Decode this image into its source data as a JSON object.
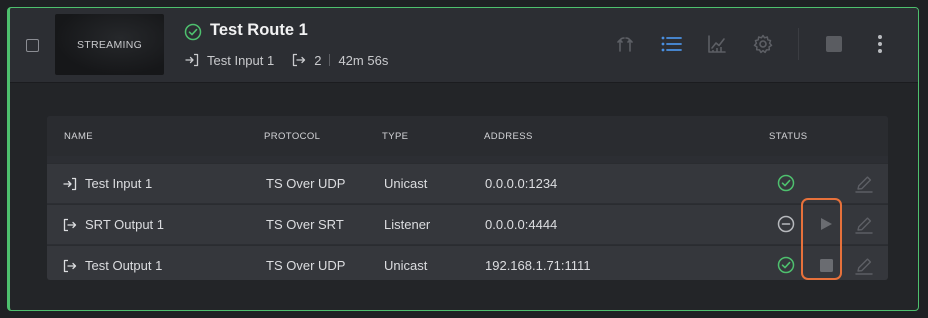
{
  "route": {
    "title": "Test Route 1",
    "status": "ok",
    "thumbnail_label": "STREAMING",
    "input_name": "Test Input 1",
    "output_count": "2",
    "uptime": "42m 56s"
  },
  "toolbar": {
    "icons": [
      "routing-icon",
      "list-icon",
      "chart-icon",
      "gear-icon",
      "stop-icon",
      "more-vertical-icon"
    ],
    "active": "list-icon"
  },
  "table": {
    "columns": [
      "NAME",
      "PROTOCOL",
      "TYPE",
      "ADDRESS",
      "STATUS"
    ],
    "rows": [
      {
        "direction": "input",
        "name": "Test Input 1",
        "protocol": "TS Over UDP",
        "type": "Unicast",
        "address": "0.0.0.0:1234",
        "status": "ok",
        "action": "none"
      },
      {
        "direction": "output",
        "name": "SRT Output 1",
        "protocol": "TS Over SRT",
        "type": "Listener",
        "address": "0.0.0.0:4444",
        "status": "stopped",
        "action": "play"
      },
      {
        "direction": "output",
        "name": "Test Output 1",
        "protocol": "TS Over UDP",
        "type": "Unicast",
        "address": "192.168.1.71:1111",
        "status": "ok",
        "action": "stop"
      }
    ]
  },
  "colors": {
    "accent_green": "#4ec06e",
    "accent_blue": "#4a90e2",
    "highlight_orange": "#e7713b"
  }
}
